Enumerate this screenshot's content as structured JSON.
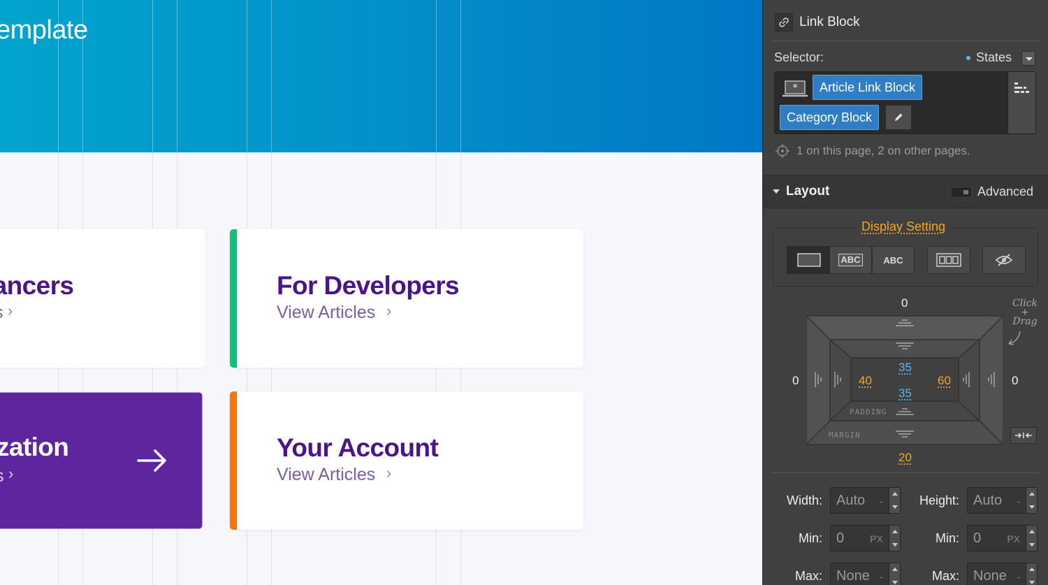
{
  "canvas": {
    "hero_title": "emplate",
    "cards": [
      {
        "title": "lancers",
        "link": "s",
        "accent": "none"
      },
      {
        "title": "For Developers",
        "link": "View Articles",
        "accent": "#13c07a"
      },
      {
        "title": "zation",
        "link": "s",
        "accent": "#5f259f"
      },
      {
        "title": "Your Account",
        "link": "View Articles",
        "accent": "#f5780d"
      }
    ],
    "chevron": "›"
  },
  "panel": {
    "element_type": "Link Block",
    "selector_label": "Selector:",
    "states_label": "States",
    "classes": [
      "Article Link Block",
      "Category Block"
    ],
    "usage": "1 on this page, 2 on other pages.",
    "section_title": "Layout",
    "advanced_label": "Advanced",
    "display_label": "Display Setting",
    "display_options": [
      "block-icon",
      "inline-block-icon",
      "inline-icon",
      "flex-icon",
      "none-icon"
    ],
    "display_text": {
      "inline_block": "ABC",
      "inline": "ABC"
    },
    "hand_note": "Click\n+\nDrag",
    "box_model": {
      "margin_top": "0",
      "margin_left": "0",
      "margin_right": "0",
      "margin_bottom": "20",
      "padding_top": "35",
      "padding_bottom": "35",
      "padding_left": "40",
      "padding_right": "60",
      "padding_label": "PADDING",
      "margin_label": "MARGIN"
    },
    "sizing": {
      "width_label": "Width:",
      "width_value": "Auto",
      "width_unit": "-",
      "height_label": "Height:",
      "height_value": "Auto",
      "height_unit": "-",
      "min_label": "Min:",
      "min_w_value": "0",
      "min_w_unit": "PX",
      "min_h_value": "0",
      "min_h_unit": "PX",
      "max_label": "Max:",
      "max_w_value": "None",
      "max_w_unit": "-",
      "max_h_value": "None",
      "max_h_unit": "-"
    },
    "colors": {
      "accent_orange": "#f5a623",
      "accent_blue": "#5db5f5",
      "class_tag": "#2f7dc4"
    }
  }
}
